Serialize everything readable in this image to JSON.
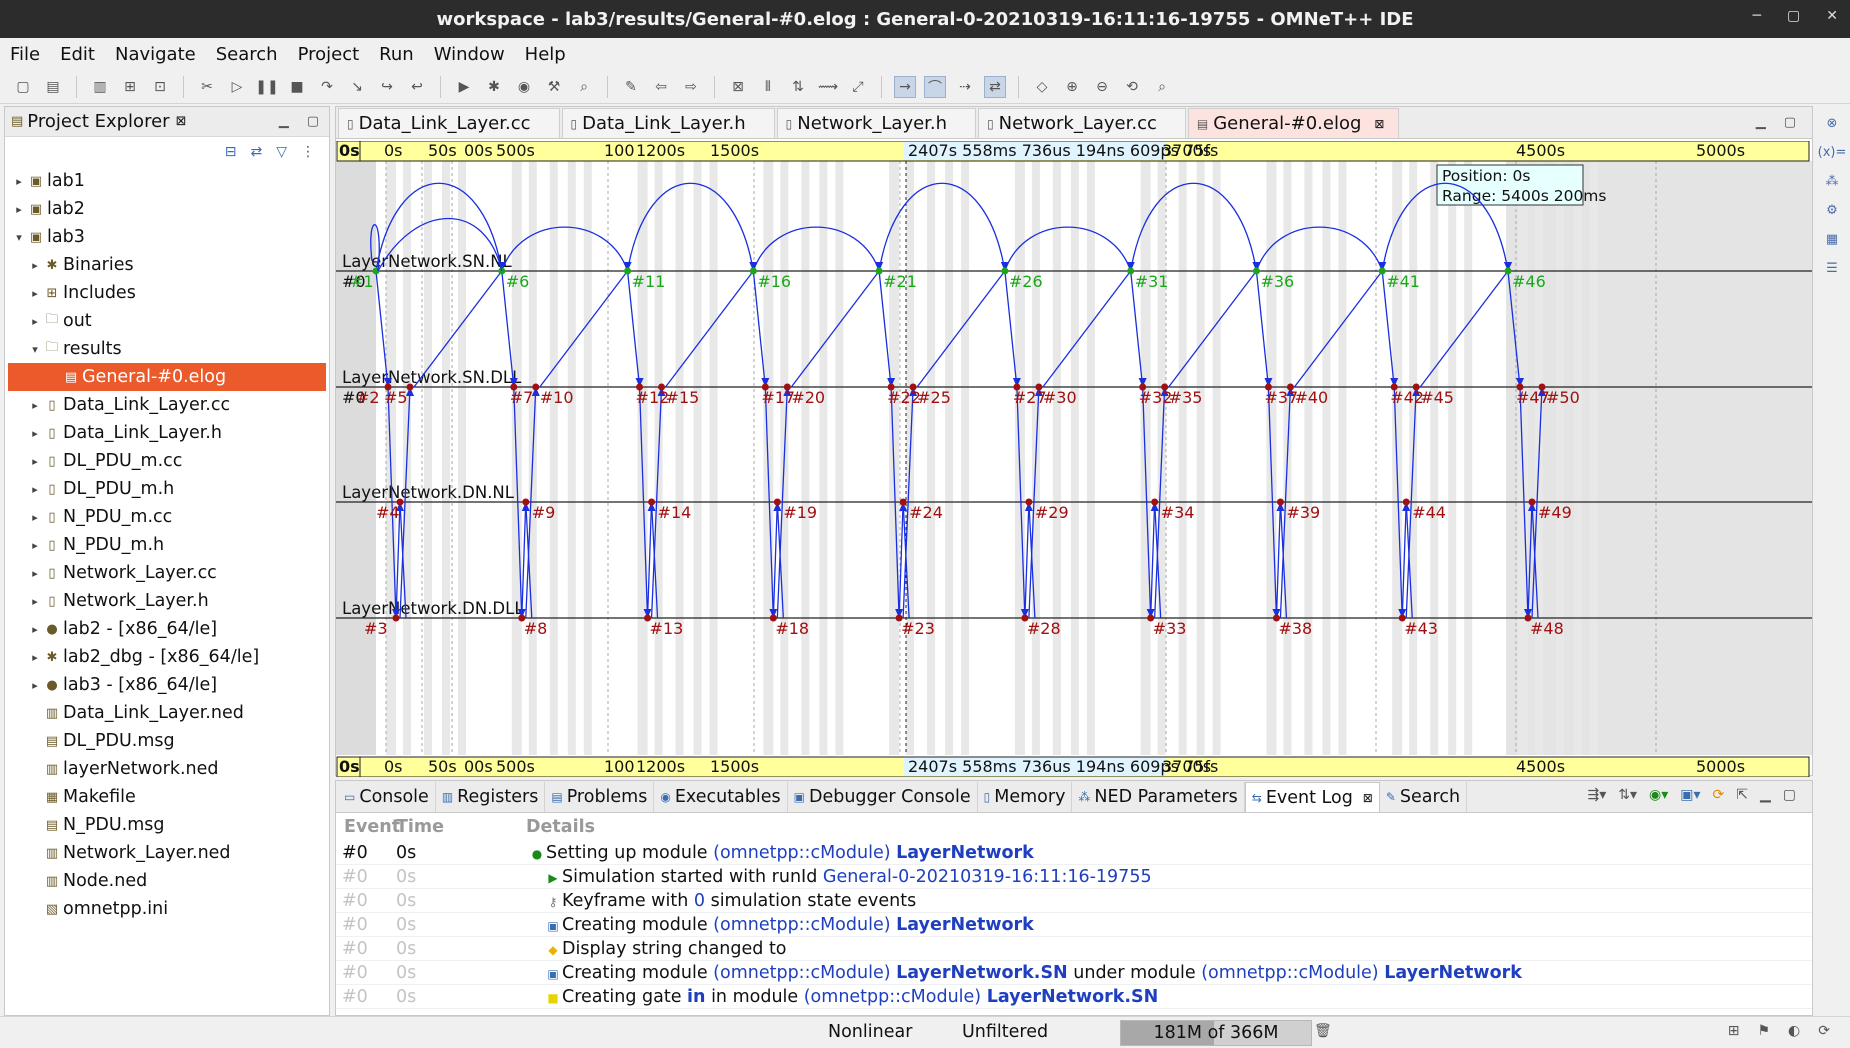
{
  "window": {
    "title": "workspace - lab3/results/General-#0.elog : General-0-20210319-16:11:16-19755 - OMNeT++ IDE"
  },
  "menu": [
    "File",
    "Edit",
    "Navigate",
    "Search",
    "Project",
    "Run",
    "Window",
    "Help"
  ],
  "explorer": {
    "title": "Project Explorer",
    "items": [
      {
        "label": "lab1",
        "depth": 0,
        "arrow": "▸",
        "icon": "project-icon"
      },
      {
        "label": "lab2",
        "depth": 0,
        "arrow": "▸",
        "icon": "project-icon"
      },
      {
        "label": "lab3",
        "depth": 0,
        "arrow": "▾",
        "icon": "project-icon"
      },
      {
        "label": "Binaries",
        "depth": 1,
        "arrow": "▸",
        "icon": "binaries-icon"
      },
      {
        "label": "Includes",
        "depth": 1,
        "arrow": "▸",
        "icon": "includes-icon"
      },
      {
        "label": "out",
        "depth": 1,
        "arrow": "▸",
        "icon": "folder-icon"
      },
      {
        "label": "results",
        "depth": 1,
        "arrow": "▾",
        "icon": "folder-icon"
      },
      {
        "label": "General-#0.elog",
        "depth": 2,
        "arrow": "",
        "icon": "elog-icon",
        "selected": true
      },
      {
        "label": "Data_Link_Layer.cc",
        "depth": 1,
        "arrow": "▸",
        "icon": "file-icon"
      },
      {
        "label": "Data_Link_Layer.h",
        "depth": 1,
        "arrow": "▸",
        "icon": "file-icon"
      },
      {
        "label": "DL_PDU_m.cc",
        "depth": 1,
        "arrow": "▸",
        "icon": "file-icon"
      },
      {
        "label": "DL_PDU_m.h",
        "depth": 1,
        "arrow": "▸",
        "icon": "file-icon"
      },
      {
        "label": "N_PDU_m.cc",
        "depth": 1,
        "arrow": "▸",
        "icon": "file-icon"
      },
      {
        "label": "N_PDU_m.h",
        "depth": 1,
        "arrow": "▸",
        "icon": "file-icon"
      },
      {
        "label": "Network_Layer.cc",
        "depth": 1,
        "arrow": "▸",
        "icon": "file-icon"
      },
      {
        "label": "Network_Layer.h",
        "depth": 1,
        "arrow": "▸",
        "icon": "file-icon"
      },
      {
        "label": "lab2 - [x86_64/le]",
        "depth": 1,
        "arrow": "▸",
        "icon": "executable-icon"
      },
      {
        "label": "lab2_dbg - [x86_64/le]",
        "depth": 1,
        "arrow": "▸",
        "icon": "debug-icon"
      },
      {
        "label": "lab3 - [x86_64/le]",
        "depth": 1,
        "arrow": "▸",
        "icon": "executable-icon"
      },
      {
        "label": "Data_Link_Layer.ned",
        "depth": 1,
        "arrow": "",
        "icon": "ned-icon"
      },
      {
        "label": "DL_PDU.msg",
        "depth": 1,
        "arrow": "",
        "icon": "msg-icon"
      },
      {
        "label": "layerNetwork.ned",
        "depth": 1,
        "arrow": "",
        "icon": "ned-icon"
      },
      {
        "label": "Makefile",
        "depth": 1,
        "arrow": "",
        "icon": "makefile-icon"
      },
      {
        "label": "N_PDU.msg",
        "depth": 1,
        "arrow": "",
        "icon": "msg-icon"
      },
      {
        "label": "Network_Layer.ned",
        "depth": 1,
        "arrow": "",
        "icon": "ned-icon"
      },
      {
        "label": "Node.ned",
        "depth": 1,
        "arrow": "",
        "icon": "ned-icon"
      },
      {
        "label": "omnetpp.ini",
        "depth": 1,
        "arrow": "",
        "icon": "ini-icon"
      }
    ]
  },
  "editor_tabs": [
    {
      "label": "Data_Link_Layer.cc",
      "active": false
    },
    {
      "label": "Data_Link_Layer.h",
      "active": false
    },
    {
      "label": "Network_Layer.h",
      "active": false
    },
    {
      "label": "Network_Layer.cc",
      "active": false
    },
    {
      "label": "General-#0.elog",
      "active": true
    }
  ],
  "chart_data": {
    "type": "sequence",
    "axis_labels": [
      "0s",
      "0s",
      "50s",
      "00s",
      "500s",
      "100",
      "1200s",
      "1500s",
      "2407s 558ms 736us 194ns 609ps 75fs",
      "3700s",
      "4500s",
      "5000s",
      "5400s 200s"
    ],
    "position_text": "Position: 0s",
    "range_text": "Range: 5400s 200ms",
    "modules": [
      "LayerNetwork.SN.NL",
      "LayerNetwork.SN.DLL",
      "LayerNetwork.DN.NL",
      "LayerNetwork.DN.DLL"
    ],
    "cycles": 10,
    "first_event": "#0",
    "events": [
      {
        "label": "#0",
        "module": 0
      },
      {
        "label": "#1",
        "module": 0
      },
      {
        "label": "#0",
        "module": 1
      },
      {
        "label": "#2",
        "module": 1
      },
      {
        "label": "#5",
        "module": 1
      },
      {
        "label": "#4",
        "module": 2
      },
      {
        "label": "#3",
        "module": 3
      }
    ]
  },
  "bottom_tabs": [
    {
      "label": "Console",
      "icon": "console-icon"
    },
    {
      "label": "Registers",
      "icon": "registers-icon"
    },
    {
      "label": "Problems",
      "icon": "problems-icon"
    },
    {
      "label": "Executables",
      "icon": "executables-icon"
    },
    {
      "label": "Debugger Console",
      "icon": "debugger-console-icon"
    },
    {
      "label": "Memory",
      "icon": "memory-icon"
    },
    {
      "label": "NED Parameters",
      "icon": "ned-parameters-icon"
    },
    {
      "label": "Event Log",
      "icon": "event-log-icon",
      "active": true
    },
    {
      "label": "Search",
      "icon": "search-icon"
    }
  ],
  "eventlog": {
    "headers": {
      "event": "Event",
      "time": "Time",
      "details": "Details"
    },
    "rows": [
      {
        "event": "#0",
        "time": "0s",
        "dim": false,
        "indent": 1,
        "marker": "●",
        "marker_color": "#1a8a1a",
        "parts": [
          {
            "t": "Setting up module "
          },
          {
            "t": "(omnetpp::cModule) ",
            "c": "blue"
          },
          {
            "t": "LayerNetwork",
            "c": "blue bold"
          }
        ]
      },
      {
        "event": "#0",
        "time": "0s",
        "dim": true,
        "indent": 2,
        "marker": "▶",
        "marker_color": "#1a8a1a",
        "parts": [
          {
            "t": "Simulation started with runId "
          },
          {
            "t": "General-0-20210319-16:11:16-19755",
            "c": "blue"
          }
        ]
      },
      {
        "event": "#0",
        "time": "0s",
        "dim": true,
        "indent": 2,
        "marker": "⚷",
        "marker_color": "#777",
        "parts": [
          {
            "t": "Keyframe with "
          },
          {
            "t": "0",
            "c": "blue"
          },
          {
            "t": " simulation state events"
          }
        ]
      },
      {
        "event": "#0",
        "time": "0s",
        "dim": true,
        "indent": 2,
        "marker": "▣",
        "marker_color": "#3a6db0",
        "parts": [
          {
            "t": "Creating module "
          },
          {
            "t": "(omnetpp::cModule) ",
            "c": "blue"
          },
          {
            "t": "LayerNetwork",
            "c": "blue bold"
          }
        ]
      },
      {
        "event": "#0",
        "time": "0s",
        "dim": true,
        "indent": 2,
        "marker": "◆",
        "marker_color": "#e8b400",
        "parts": [
          {
            "t": "Display string changed to"
          }
        ]
      },
      {
        "event": "#0",
        "time": "0s",
        "dim": true,
        "indent": 2,
        "marker": "▣",
        "marker_color": "#3a6db0",
        "parts": [
          {
            "t": "Creating module "
          },
          {
            "t": "(omnetpp::cModule) ",
            "c": "blue"
          },
          {
            "t": "LayerNetwork.SN",
            "c": "blue bold"
          },
          {
            "t": " under module "
          },
          {
            "t": "(omnetpp::cModule) ",
            "c": "blue"
          },
          {
            "t": "LayerNetwork",
            "c": "blue bold"
          }
        ]
      },
      {
        "event": "#0",
        "time": "0s",
        "dim": true,
        "indent": 2,
        "marker": "■",
        "marker_color": "#e8d400",
        "parts": [
          {
            "t": "Creating gate "
          },
          {
            "t": "in",
            "c": "blue bold"
          },
          {
            "t": " in module "
          },
          {
            "t": "(omnetpp::cModule) ",
            "c": "blue"
          },
          {
            "t": "LayerNetwork.SN",
            "c": "blue bold"
          }
        ]
      }
    ]
  },
  "status": {
    "mode": "Nonlinear",
    "filter": "Unfiltered",
    "memory": "181M of 366M",
    "memory_used_fraction": 0.49
  },
  "colors": {
    "accent": "#ea5a2a",
    "arc": "#1a2fe0",
    "nl_event": "#1aa81a",
    "dll_event": "#a01010",
    "timebar": "#ffff9c"
  }
}
